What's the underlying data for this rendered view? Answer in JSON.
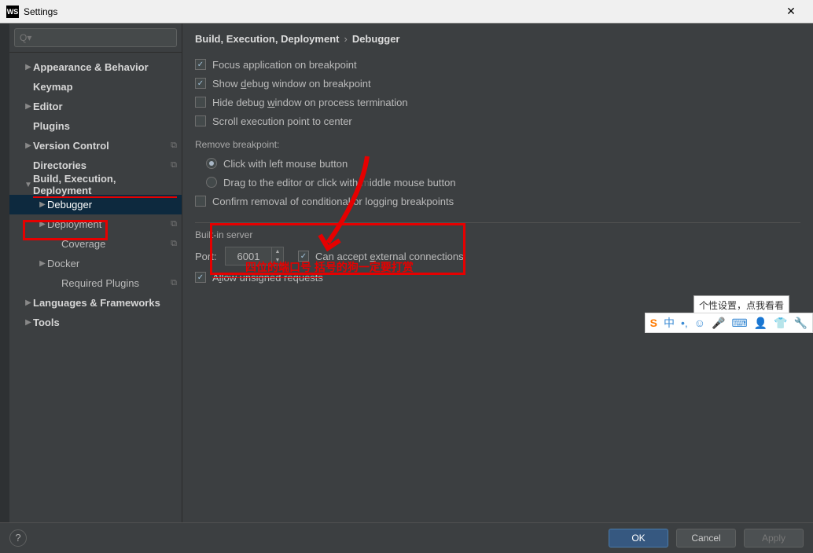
{
  "window": {
    "title": "Settings",
    "icon_text": "WS"
  },
  "search": {
    "placeholder": "Q▾"
  },
  "sidebar": {
    "items": [
      {
        "label": "Appearance & Behavior",
        "arrow": "collapsed",
        "bold": true,
        "lvl": 0
      },
      {
        "label": "Keymap",
        "bold": true,
        "lvl": 0
      },
      {
        "label": "Editor",
        "arrow": "collapsed",
        "bold": true,
        "lvl": 0
      },
      {
        "label": "Plugins",
        "bold": true,
        "lvl": 0
      },
      {
        "label": "Version Control",
        "arrow": "collapsed",
        "bold": true,
        "badge": "⃞",
        "lvl": 0
      },
      {
        "label": "Directories",
        "bold": true,
        "badge": "⃞",
        "lvl": 0
      },
      {
        "label": "Build, Execution, Deployment",
        "arrow": "expanded",
        "bold": true,
        "lvl": 0,
        "underline_red": true
      },
      {
        "label": "Debugger",
        "arrow": "collapsed",
        "lvl": 1,
        "active": true
      },
      {
        "label": "Deployment",
        "arrow": "collapsed",
        "badge": "⃞",
        "lvl": 1
      },
      {
        "label": "Coverage",
        "badge": "⃞",
        "lvl": 2
      },
      {
        "label": "Docker",
        "arrow": "collapsed",
        "lvl": 1
      },
      {
        "label": "Required Plugins",
        "badge": "⃞",
        "lvl": 2
      },
      {
        "label": "Languages & Frameworks",
        "arrow": "collapsed",
        "bold": true,
        "lvl": 0
      },
      {
        "label": "Tools",
        "arrow": "collapsed",
        "bold": true,
        "lvl": 0
      }
    ]
  },
  "breadcrumb": {
    "a": "Build, Execution, Deployment",
    "b": "Debugger"
  },
  "options": {
    "focus_app": {
      "label": "Focus application on breakpoint",
      "checked": true
    },
    "show_debug": {
      "pre": "Show ",
      "m": "d",
      "post": "ebug window on breakpoint",
      "checked": true
    },
    "hide_debug": {
      "pre": "Hide debug ",
      "m": "w",
      "post": "indow on process termination",
      "checked": false
    },
    "scroll_exec": {
      "label": "Scroll execution point to center",
      "checked": false
    }
  },
  "remove_bp": {
    "title": "Remove breakpoint:",
    "r1": "Click with left mouse button",
    "r2_pre": "Drag to the editor or click with ",
    "r2_post": "iddle mouse button",
    "confirm": "Confirm removal of conditional or logging breakpoints"
  },
  "builtin": {
    "title": "Built-in server",
    "port_label": "Port:",
    "port_value": "6001",
    "can_accept_pre": "Can accept ",
    "can_accept_m": "e",
    "can_accept_post": "xternal connections",
    "allow_pre": "A",
    "allow_m": "l",
    "allow_post": "low unsigned requests"
  },
  "annotations": {
    "text": "四位的端口号 括号的狗一定要打赏"
  },
  "footer": {
    "ok": "OK",
    "cancel": "Cancel",
    "apply": "Apply"
  },
  "ime": {
    "tip": "个性设置，点我看看",
    "s": "S",
    "zh": "中"
  }
}
